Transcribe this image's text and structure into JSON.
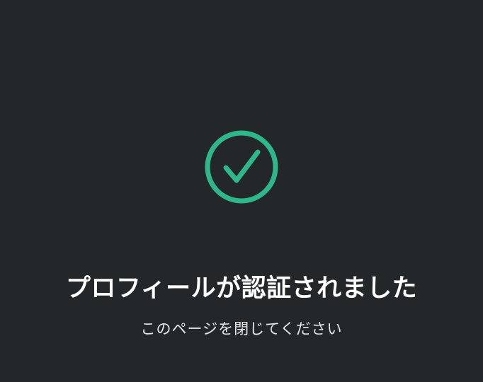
{
  "status": {
    "icon": "check-circle-icon",
    "accent_color": "#2eb78a",
    "background_color": "#24272a",
    "title": "プロフィールが認証されました",
    "message": "このページを閉じてください"
  }
}
